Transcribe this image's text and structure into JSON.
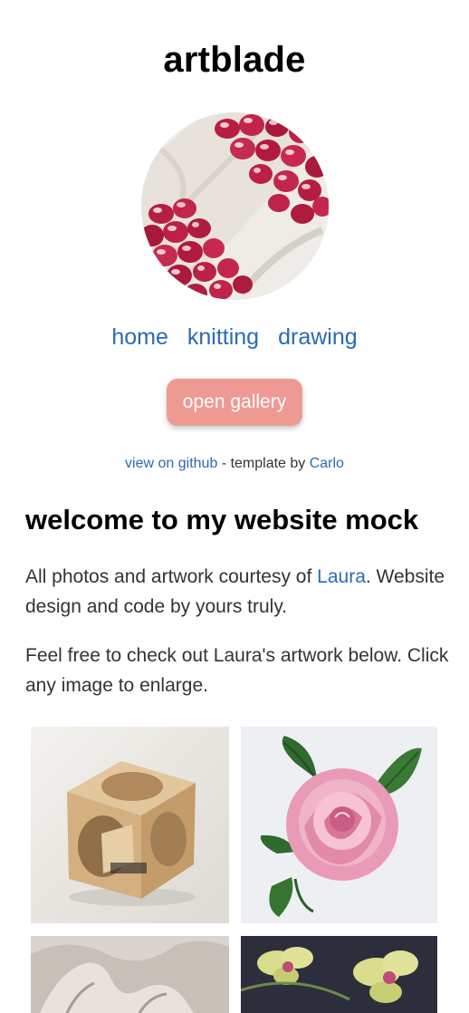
{
  "site": {
    "title": "artblade"
  },
  "nav": {
    "items": [
      {
        "label": "home"
      },
      {
        "label": "knitting"
      },
      {
        "label": "drawing"
      }
    ]
  },
  "gallery_button": {
    "label": "open gallery"
  },
  "credits": {
    "github_link": "view on github",
    "separator": " - template by ",
    "author_link": "Carlo"
  },
  "content": {
    "heading": "welcome to my website mock",
    "para1_before": "All photos and artwork courtesy of ",
    "para1_link": "Laura",
    "para1_after": ". Website design and code by yours truly.",
    "para2": "Feel free to check out Laura's artwork below. Click any image to enlarge."
  },
  "gallery": {
    "images": [
      {
        "subject": "wooden-cube-carving"
      },
      {
        "subject": "pink-rose-drawing"
      },
      {
        "subject": "draped-fabric-drawing"
      },
      {
        "subject": "orchid-painting"
      }
    ]
  },
  "colors": {
    "link": "#2a6bb3",
    "button_bg": "#ee9a93",
    "heading": "#000000",
    "body_text": "#333333"
  }
}
